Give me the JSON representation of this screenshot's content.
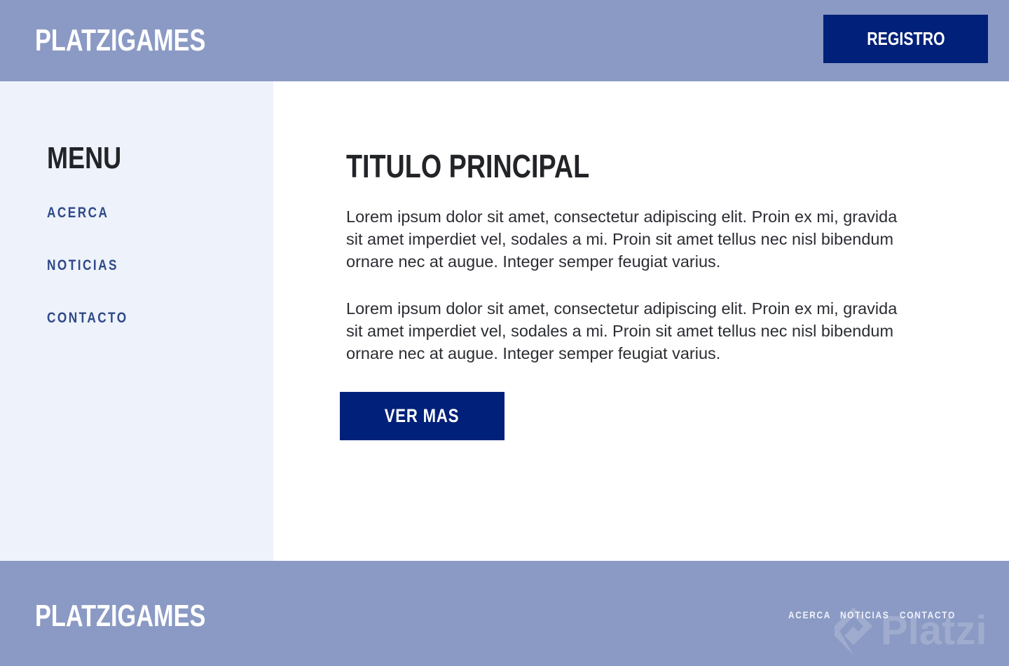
{
  "header": {
    "brand": "PLATZIGAMES",
    "register_label": "REGISTRO"
  },
  "sidebar": {
    "title": "MENU",
    "items": [
      {
        "label": "ACERCA"
      },
      {
        "label": "NOTICIAS"
      },
      {
        "label": "CONTACTO"
      }
    ]
  },
  "main": {
    "title": "TITULO PRINCIPAL",
    "paragraphs": [
      "Lorem ipsum dolor sit amet, consectetur adipiscing elit. Proin ex mi, gravida sit amet imperdiet vel, sodales a mi. Proin sit amet tellus nec nisl bibendum ornare nec at augue. Integer semper feugiat varius.",
      "Lorem ipsum dolor sit amet, consectetur adipiscing elit. Proin ex mi, gravida sit amet imperdiet vel, sodales a mi. Proin sit amet tellus nec nisl bibendum ornare nec at augue. Integer semper feugiat varius."
    ],
    "more_label": "VER MAS"
  },
  "footer": {
    "brand": "PLATZIGAMES",
    "links": [
      {
        "label": "ACERCA"
      },
      {
        "label": "NOTICIAS"
      },
      {
        "label": "CONTACTO"
      }
    ],
    "watermark": "Platzi"
  },
  "colors": {
    "header_bg": "#8b9ac4",
    "sidebar_bg": "#eef2fb",
    "button_bg": "#002079",
    "link_color": "#2f4a88",
    "text_dark": "#222428"
  }
}
